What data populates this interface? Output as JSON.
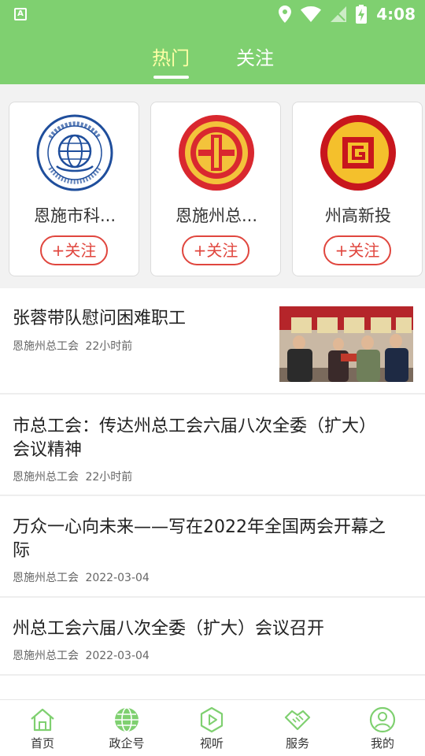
{
  "status_bar": {
    "time": "4:08",
    "left_icon": "A"
  },
  "tabs": [
    {
      "label": "热门",
      "active": true
    },
    {
      "label": "关注",
      "active": false
    }
  ],
  "colors": {
    "header_green": "#7fd070",
    "active_tab": "#ffffa6",
    "follow_red": "#e0463e"
  },
  "follow_cards": [
    {
      "name": "恩施市科...",
      "button": "+关注",
      "logo": "science-association-logo-icon"
    },
    {
      "name": "恩施州总...",
      "button": "+关注",
      "logo": "trade-union-logo-icon"
    },
    {
      "name": "州高新投",
      "button": "+关注",
      "logo": "high-tech-investment-logo-icon"
    }
  ],
  "news": [
    {
      "title": "张蓉带队慰问困难职工",
      "source": "恩施州总工会",
      "time": "22小时前",
      "has_image": true
    },
    {
      "title": "市总工会：传达州总工会六届八次全委（扩大）会议精神",
      "source": "恩施州总工会",
      "time": "22小时前"
    },
    {
      "title": "万众一心向未来——写在2022年全国两会开幕之际",
      "source": "恩施州总工会",
      "time": "2022-03-04"
    },
    {
      "title": "州总工会六届八次全委（扩大）会议召开",
      "source": "恩施州总工会",
      "time": "2022-03-04"
    }
  ],
  "bottom_nav": [
    {
      "label": "首页",
      "icon": "home-icon"
    },
    {
      "label": "政企号",
      "icon": "globe-icon"
    },
    {
      "label": "视听",
      "icon": "play-icon"
    },
    {
      "label": "服务",
      "icon": "handshake-icon"
    },
    {
      "label": "我的",
      "icon": "user-icon"
    }
  ]
}
